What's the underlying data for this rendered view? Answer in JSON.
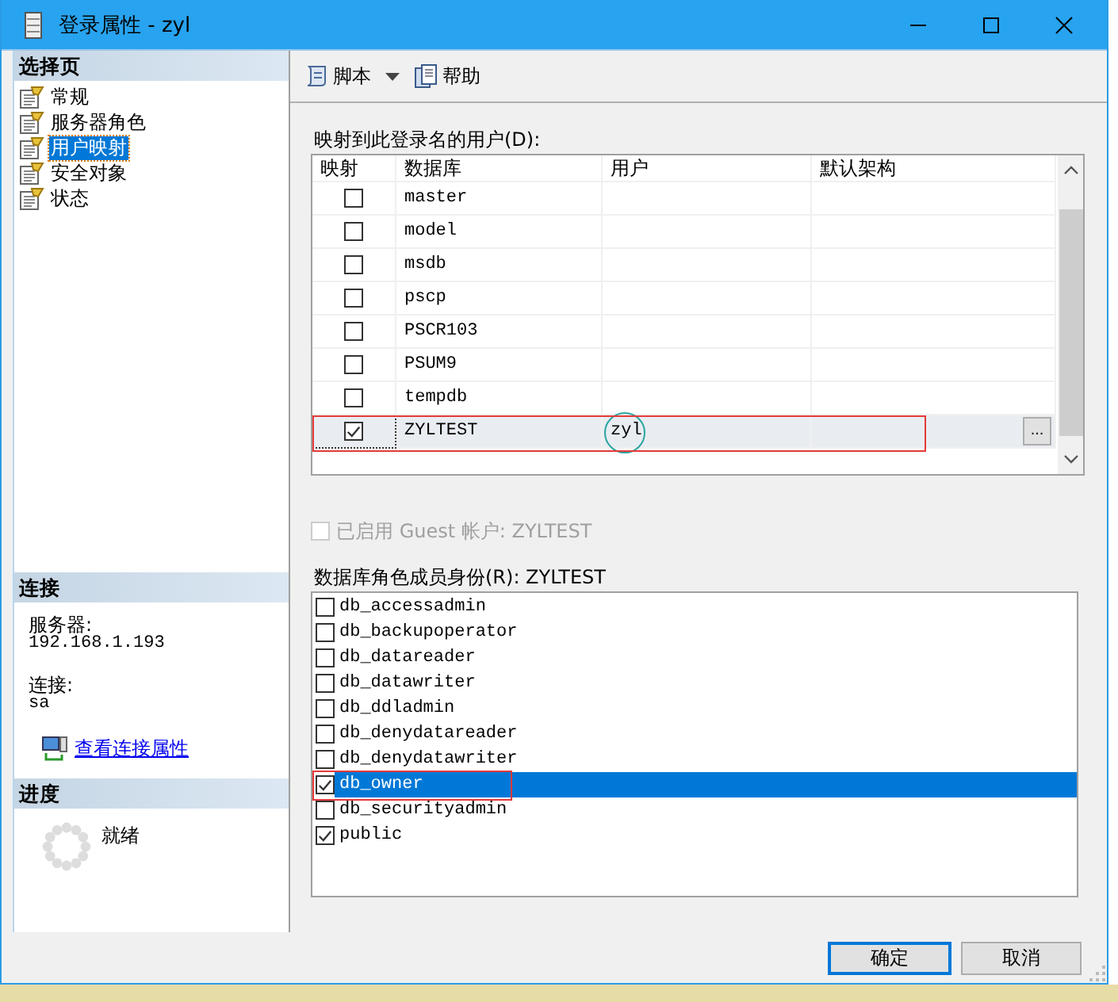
{
  "window": {
    "title": "登录属性 - zyl"
  },
  "sidebar": {
    "header": "选择页",
    "items": [
      {
        "label": "常规",
        "selected": false
      },
      {
        "label": "服务器角色",
        "selected": false
      },
      {
        "label": "用户映射",
        "selected": true
      },
      {
        "label": "安全对象",
        "selected": false
      },
      {
        "label": "状态",
        "selected": false
      }
    ]
  },
  "connection": {
    "header": "连接",
    "server_label": "服务器:",
    "server": "192.168.1.193",
    "login_label": "连接:",
    "login": "sa",
    "link": "查看连接属性"
  },
  "progress": {
    "header": "进度",
    "status": "就绪"
  },
  "toolbar": [
    {
      "kind": "script",
      "label": "脚本",
      "dropdown": true
    },
    {
      "kind": "help",
      "label": "帮助",
      "dropdown": false
    }
  ],
  "user_mapping": {
    "label": "映射到此登录名的用户(D):",
    "columns": [
      "映射",
      "数据库",
      "用户",
      "默认架构"
    ],
    "rows": [
      {
        "mapped": false,
        "database": "master",
        "selected": false,
        "marked": false
      },
      {
        "mapped": false,
        "database": "model",
        "selected": false,
        "marked": false
      },
      {
        "mapped": false,
        "database": "msdb",
        "selected": false,
        "marked": false
      },
      {
        "mapped": false,
        "database": "pscp",
        "selected": false,
        "marked": false
      },
      {
        "mapped": false,
        "database": "PSCR103",
        "selected": false,
        "marked": false
      },
      {
        "mapped": false,
        "database": "PSUM9",
        "selected": false,
        "marked": false
      },
      {
        "mapped": false,
        "database": "tempdb",
        "selected": false,
        "marked": false
      },
      {
        "mapped": true,
        "database": "ZYLTEST",
        "user": "zyl",
        "user_circled": true,
        "browse": "...",
        "selected": true,
        "marked": true
      }
    ]
  },
  "guest": {
    "label": "已启用 Guest 帐户: ZYLTEST",
    "checked": false,
    "disabled": true
  },
  "roles": {
    "label": "数据库角色成员身份(R): ZYLTEST",
    "items": [
      {
        "name": "db_accessadmin",
        "checked": false,
        "selected": false,
        "marked": false
      },
      {
        "name": "db_backupoperator",
        "checked": false,
        "selected": false,
        "marked": false
      },
      {
        "name": "db_datareader",
        "checked": false,
        "selected": false,
        "marked": false
      },
      {
        "name": "db_datawriter",
        "checked": false,
        "selected": false,
        "marked": false
      },
      {
        "name": "db_ddladmin",
        "checked": false,
        "selected": false,
        "marked": false
      },
      {
        "name": "db_denydatareader",
        "checked": false,
        "selected": false,
        "marked": false
      },
      {
        "name": "db_denydatawriter",
        "checked": false,
        "selected": false,
        "marked": false
      },
      {
        "name": "db_owner",
        "checked": true,
        "selected": true,
        "marked": true
      },
      {
        "name": "db_securityadmin",
        "checked": false,
        "selected": false,
        "marked": false
      },
      {
        "name": "public",
        "checked": true,
        "selected": false,
        "marked": false
      }
    ]
  },
  "buttons": [
    {
      "label": "确定",
      "default": true
    },
    {
      "label": "取消",
      "default": false
    }
  ]
}
